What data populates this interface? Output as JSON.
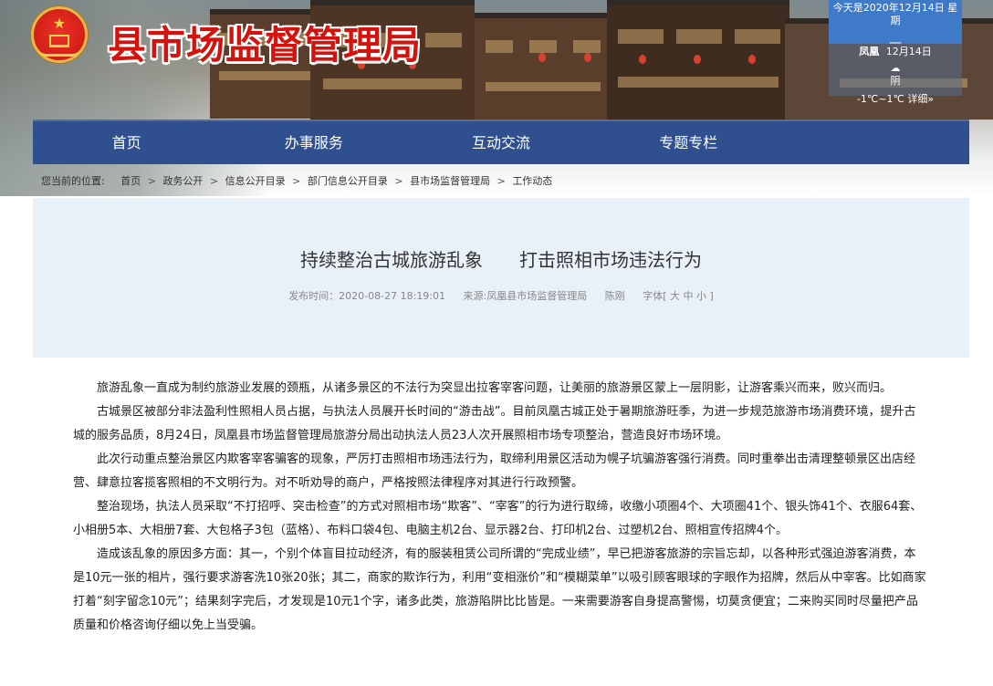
{
  "site": {
    "title": "县市场监督管理局"
  },
  "weather": {
    "today": "今天是2020年12月14日 星期",
    "dash": "—",
    "city": "凤凰",
    "date": "12月14日",
    "condition": "阴",
    "temperature": "-1℃~1℃",
    "detail_link": "详细»"
  },
  "nav": {
    "items": [
      {
        "label": "首页"
      },
      {
        "label": "办事服务"
      },
      {
        "label": "互动交流"
      },
      {
        "label": "专题专栏"
      },
      {
        "label": ""
      }
    ]
  },
  "breadcrumb": {
    "lead": "您当前的位置:",
    "items": [
      "首页",
      "政务公开",
      "信息公开目录",
      "部门信息公开目录",
      "县市场监督管理局",
      "工作动态"
    ],
    "separator": ">"
  },
  "article": {
    "title": "持续整治古城旅游乱象　　打击照相市场违法行为",
    "published": "发布时间：2020-08-27 18:19:01",
    "source": "来源:凤凰县市场监督管理局",
    "author": "陈刚",
    "font_size_label": "字体[ 大 中 小 ]",
    "paragraphs": [
      "旅游乱象一直成为制约旅游业发展的颈瓶，从诸多景区的不法行为突显出拉客宰客问题，让美丽的旅游景区蒙上一层阴影，让游客乘兴而来，败兴而归。",
      "古城景区被部分非法盈利性照相人员占据，与执法人员展开长时间的“游击战”。目前凤凰古城正处于暑期旅游旺季，为进一步规范旅游市场消费环境，提升古城的服务品质，8月24日，凤凰县市场监督管理局旅游分局出动执法人员23人次开展照相市场专项整治，营造良好市场环境。",
      "此次行动重点整治景区内欺客宰客骗客的现象，严厉打击照相市场违法行为，取缔利用景区活动为幌子坑骗游客强行消费。同时重拳出击清理整顿景区出店经营、肆意拉客揽客照相的不文明行为。对不听劝导的商户，严格按照法律程序对其进行行政预警。",
      "整治现场，执法人员采取“不打招呼、突击检查”的方式对照相市场“欺客”、“宰客”的行为进行取缔，收缴小项圈4个、大项圈41个、银头饰41个、衣服64套、小相册5本、大相册7套、大包格子3包（蓝格）、布料口袋4包、电脑主机2台、显示器2台、打印机2台、过塑机2台、照相宣传招牌4个。",
      "造成该乱象的原因多方面：其一，个别个体盲目拉动经济，有的服装租赁公司所谓的“完成业绩”，早已把游客旅游的宗旨忘却，以各种形式强迫游客消费，本是10元一张的相片，强行要求游客洗10张20张；其二，商家的欺诈行为，利用“变相涨价”和“模糊菜单”以吸引顾客眼球的字眼作为招牌，然后从中宰客。比如商家打着“刻字留念10元”；结果刻字完后，才发现是10元1个字，诸多此类，旅游陷阱比比皆是。一来需要游客自身提高警惕，切莫贪便宜；二来购买同时尽量把产品质量和价格咨询仔细以免上当受骗。"
    ]
  },
  "colors": {
    "title_red": "#d3140e",
    "nav_blue": "#2f4f8f",
    "header_bg": "#e8f0f8",
    "weather_blue": "#3f7ac9"
  }
}
